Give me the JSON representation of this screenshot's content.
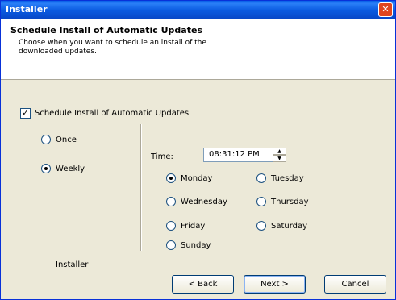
{
  "window": {
    "title": "Installer"
  },
  "header": {
    "title": "Schedule Install of Automatic Updates",
    "description": "Choose when you want to schedule an install of the downloaded updates."
  },
  "schedule_checkbox": {
    "label": "Schedule Install of Automatic Updates",
    "checked": true
  },
  "frequency": {
    "once_label": "Once",
    "weekly_label": "Weekly",
    "selected": "Weekly"
  },
  "time": {
    "label": "Time:",
    "value": "08:31:12 PM"
  },
  "days": {
    "monday": "Monday",
    "tuesday": "Tuesday",
    "wednesday": "Wednesday",
    "thursday": "Thursday",
    "friday": "Friday",
    "saturday": "Saturday",
    "sunday": "Sunday",
    "selected": "Monday"
  },
  "footer": {
    "label": "Installer",
    "back": "< Back",
    "next": "Next >",
    "cancel": "Cancel"
  }
}
